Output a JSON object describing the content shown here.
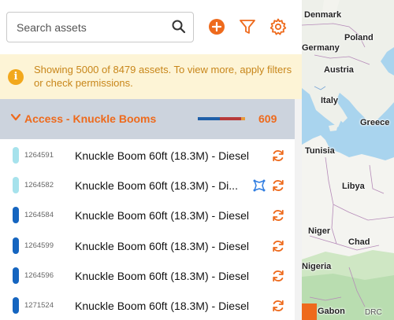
{
  "search": {
    "placeholder": "Search assets"
  },
  "toolbar": {
    "add_icon": "plus-circle-icon",
    "filter_icon": "funnel-icon",
    "settings_icon": "gear-icon"
  },
  "notice": {
    "text": "Showing 5000 of 8479 assets. To view more, apply filters or check permissions."
  },
  "group": {
    "title": "Access - Knuckle Booms",
    "count": "609",
    "status_bar": [
      {
        "color": "#1f5fa8",
        "fraction": 0.47
      },
      {
        "color": "#b73a3a",
        "fraction": 0.45
      },
      {
        "color": "#e79a3c",
        "fraction": 0.08
      }
    ]
  },
  "assets": [
    {
      "id": "1264591",
      "name": "Knuckle Boom 60ft (18.3M) - Diesel",
      "status_color": "#a6e2ec",
      "map_icon": false
    },
    {
      "id": "1264582",
      "name": "Knuckle Boom 60ft (18.3M) - Di...",
      "status_color": "#a6e2ec",
      "map_icon": true
    },
    {
      "id": "1264584",
      "name": "Knuckle Boom 60ft (18.3M) - Diesel",
      "status_color": "#1565c0",
      "map_icon": false
    },
    {
      "id": "1264599",
      "name": "Knuckle Boom 60ft (18.3M) - Diesel",
      "status_color": "#1565c0",
      "map_icon": false
    },
    {
      "id": "1264596",
      "name": "Knuckle Boom 60ft (18.3M) - Diesel",
      "status_color": "#1565c0",
      "map_icon": false
    },
    {
      "id": "1271524",
      "name": "Knuckle Boom 60ft (18.3M) - Diesel",
      "status_color": "#1565c0",
      "map_icon": false
    }
  ],
  "map": {
    "labels": [
      "Denmark",
      "Poland",
      "Germany",
      "Austria",
      "Italy",
      "Greece",
      "Tunisia",
      "Libya",
      "Niger",
      "Chad",
      "Nigeria",
      "Gabon",
      "DRC"
    ]
  },
  "colors": {
    "accent": "#ee6a1c",
    "notice_bg": "#fdf4d6",
    "group_bg": "#ccd3dd"
  }
}
